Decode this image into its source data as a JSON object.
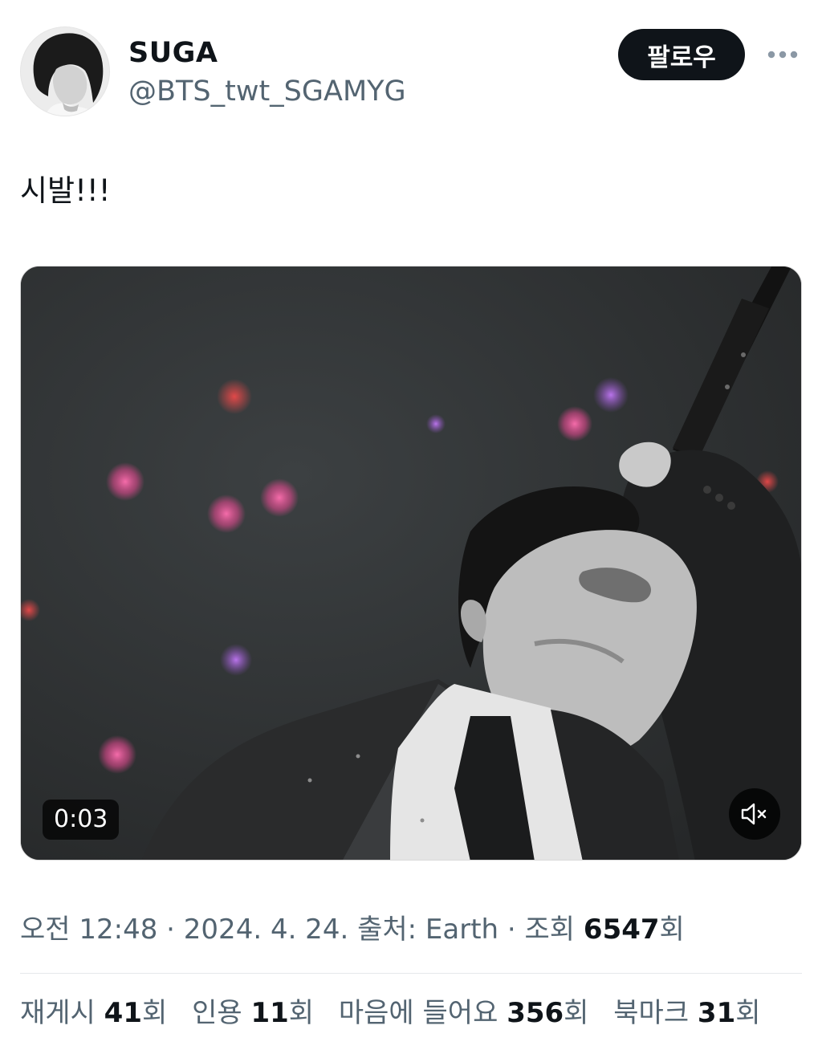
{
  "header": {
    "display_name": "SUGA",
    "handle": "@BTS_twt_SGAMYG",
    "follow_label": "팔로우",
    "more_icon": "more-horizontal-icon",
    "avatar": "user-avatar"
  },
  "tweet": {
    "text": "시발!!!"
  },
  "media": {
    "type": "video",
    "duration": "0:03",
    "mute_icon": "speaker-muted-icon"
  },
  "meta": {
    "time": "오전 12:48",
    "separator": "·",
    "date": "2024. 4. 24.",
    "source_label": "출처:",
    "source": "Earth",
    "views_label": "조회",
    "views": "6547",
    "views_unit": "회"
  },
  "stats": {
    "retweets_label": "재게시",
    "retweets": "41",
    "quotes_label": "인용",
    "quotes": "11",
    "likes_label": "마음에 들어요",
    "likes": "356",
    "bookmarks_label": "북마크",
    "bookmarks": "31",
    "unit": "회"
  },
  "colors": {
    "text_primary": "#0f1419",
    "text_secondary": "#536471",
    "follow_bg": "#0f1419",
    "divider": "#e6e9eb"
  }
}
